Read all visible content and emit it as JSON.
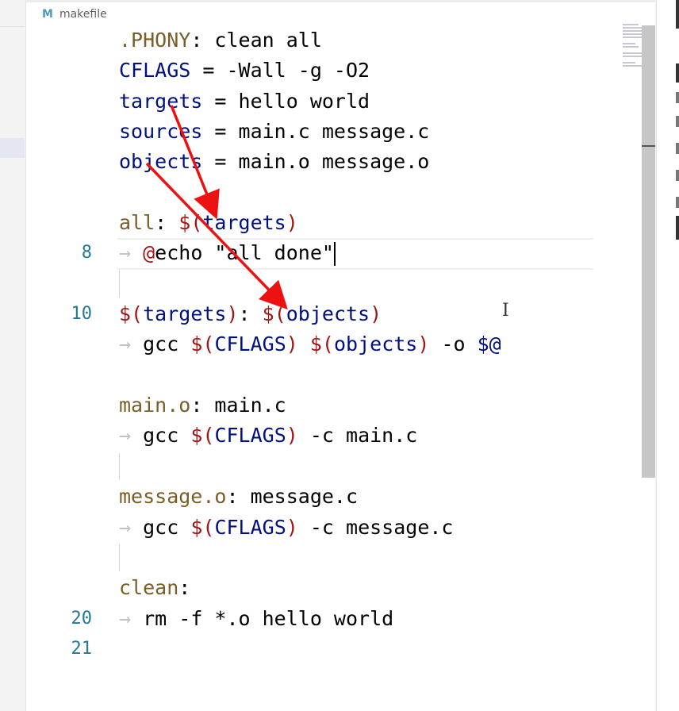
{
  "editor": {
    "breadcrumb": {
      "icon": "M",
      "file": "makefile"
    },
    "cursor_line": 8,
    "lines": [
      {
        "n": "",
        "tokens": [
          {
            "t": ".PHONY",
            "c": "target"
          },
          {
            "t": ": clean all",
            "c": "plain"
          }
        ]
      },
      {
        "n": "",
        "tokens": [
          {
            "t": "CFLAGS",
            "c": "var"
          },
          {
            "t": " = -Wall -g -O2",
            "c": "plain"
          }
        ]
      },
      {
        "n": "",
        "tokens": [
          {
            "t": "targets",
            "c": "var"
          },
          {
            "t": " = hello world",
            "c": "plain"
          }
        ]
      },
      {
        "n": "",
        "tokens": [
          {
            "t": "sources",
            "c": "var"
          },
          {
            "t": " = main.c message.c",
            "c": "plain"
          }
        ]
      },
      {
        "n": "",
        "tokens": [
          {
            "t": "objects",
            "c": "var"
          },
          {
            "t": " = main.o message.o",
            "c": "plain"
          }
        ]
      },
      {
        "n": "",
        "tokens": []
      },
      {
        "n": "",
        "tokens": [
          {
            "t": "all",
            "c": "target"
          },
          {
            "t": ": ",
            "c": "plain"
          },
          {
            "t": "$(",
            "c": "dollar"
          },
          {
            "t": "targets",
            "c": "var"
          },
          {
            "t": ")",
            "c": "dollar"
          }
        ]
      },
      {
        "n": "8",
        "tab": true,
        "caret": true,
        "tokens": [
          {
            "t": "@",
            "c": "at"
          },
          {
            "t": "echo \"all done\"",
            "c": "plain"
          }
        ]
      },
      {
        "n": "",
        "tabguide": true,
        "tokens": []
      },
      {
        "n": "10",
        "tokens": [
          {
            "t": "$(",
            "c": "dollar"
          },
          {
            "t": "targets",
            "c": "var"
          },
          {
            "t": ")",
            "c": "dollar"
          },
          {
            "t": ": ",
            "c": "plain"
          },
          {
            "t": "$(",
            "c": "dollar"
          },
          {
            "t": "objects",
            "c": "var"
          },
          {
            "t": ")",
            "c": "dollar"
          }
        ]
      },
      {
        "n": "",
        "tab": true,
        "tokens": [
          {
            "t": "gcc ",
            "c": "plain"
          },
          {
            "t": "$(",
            "c": "dollar"
          },
          {
            "t": "CFLAGS",
            "c": "var"
          },
          {
            "t": ")",
            "c": "dollar"
          },
          {
            "t": " ",
            "c": "plain"
          },
          {
            "t": "$(",
            "c": "dollar"
          },
          {
            "t": "objects",
            "c": "var"
          },
          {
            "t": ")",
            "c": "dollar"
          },
          {
            "t": " -o ",
            "c": "plain"
          },
          {
            "t": "$@",
            "c": "var"
          }
        ]
      },
      {
        "n": "",
        "tokens": []
      },
      {
        "n": "",
        "tokens": [
          {
            "t": "main.o",
            "c": "target"
          },
          {
            "t": ": main.c",
            "c": "plain"
          }
        ]
      },
      {
        "n": "",
        "tab": true,
        "tokens": [
          {
            "t": "gcc ",
            "c": "plain"
          },
          {
            "t": "$(",
            "c": "dollar"
          },
          {
            "t": "CFLAGS",
            "c": "var"
          },
          {
            "t": ")",
            "c": "dollar"
          },
          {
            "t": " -c main.c",
            "c": "plain"
          }
        ]
      },
      {
        "n": "",
        "tabguide": true,
        "tokens": []
      },
      {
        "n": "",
        "tokens": [
          {
            "t": "message.o",
            "c": "target"
          },
          {
            "t": ": message.c",
            "c": "plain"
          }
        ]
      },
      {
        "n": "",
        "tab": true,
        "tokens": [
          {
            "t": "gcc ",
            "c": "plain"
          },
          {
            "t": "$(",
            "c": "dollar"
          },
          {
            "t": "CFLAGS",
            "c": "var"
          },
          {
            "t": ")",
            "c": "dollar"
          },
          {
            "t": " -c message.c",
            "c": "plain"
          }
        ]
      },
      {
        "n": "",
        "tabguide": true,
        "tokens": []
      },
      {
        "n": "",
        "tokens": [
          {
            "t": "clean",
            "c": "target"
          },
          {
            "t": ":",
            "c": "plain"
          }
        ]
      },
      {
        "n": "20",
        "tab": true,
        "tokens": [
          {
            "t": "rm -f *.o hello world",
            "c": "plain"
          }
        ]
      },
      {
        "n": "21",
        "tokens": []
      }
    ],
    "tab_glyph": "→",
    "colors": {
      "target": "#795e26",
      "var": "#001080",
      "dollar": "#a31515",
      "line_number": "#237893",
      "annotation_arrow": "#ee1111"
    }
  },
  "icons": {
    "file_icon": "markdown-m-icon",
    "cursor": "ibeam-cursor-icon"
  }
}
